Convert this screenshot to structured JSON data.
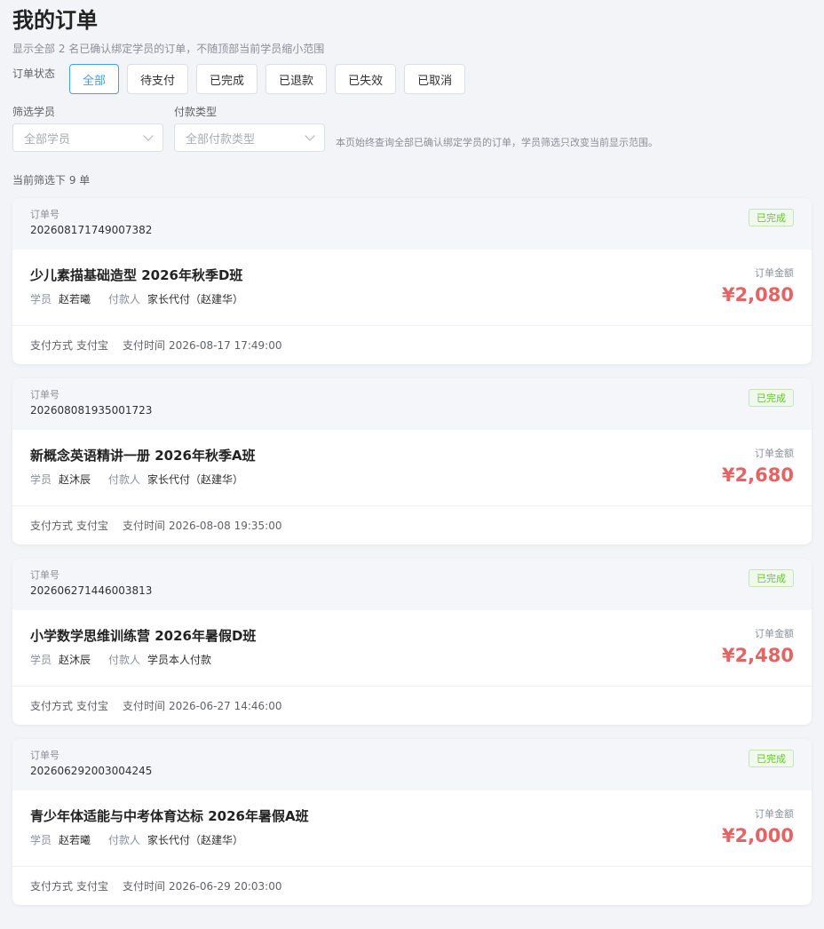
{
  "header": {
    "title": "我的订单",
    "subtitle": "显示全部 2 名已确认绑定学员的订单，不随顶部当前学员缩小范围"
  },
  "status_filter": {
    "label": "订单状态",
    "options": [
      "全部",
      "待支付",
      "已完成",
      "已退款",
      "已失效",
      "已取消"
    ],
    "selected": "全部"
  },
  "filters": {
    "student_label": "筛选学员",
    "student_placeholder": "全部学员",
    "payment_label": "付款类型",
    "payment_placeholder": "全部付款类型",
    "note": "本页始终查询全部已确认绑定学员的订单，学员筛选只改变当前显示范围。"
  },
  "count_text": "当前筛选下 9 单",
  "labels": {
    "order_no": "订单号",
    "amount": "订单金额",
    "student": "学员",
    "payer": "付款人",
    "pay_method": "支付方式",
    "pay_time": "支付时间"
  },
  "colors": {
    "accent": "#409eff",
    "amount": "#e56363",
    "success": "#67c23a"
  },
  "orders": [
    {
      "order_no": "202608171749007382",
      "status": "已完成",
      "course": "少儿素描基础造型 2026年秋季D班",
      "student": "赵若曦",
      "payer": "家长代付（赵建华）",
      "amount": "¥2,080",
      "pay_method": "支付宝",
      "pay_time": "2026-08-17 17:49:00"
    },
    {
      "order_no": "202608081935001723",
      "status": "已完成",
      "course": "新概念英语精讲一册 2026年秋季A班",
      "student": "赵沐辰",
      "payer": "家长代付（赵建华）",
      "amount": "¥2,680",
      "pay_method": "支付宝",
      "pay_time": "2026-08-08 19:35:00"
    },
    {
      "order_no": "202606271446003813",
      "status": "已完成",
      "course": "小学数学思维训练营 2026年暑假D班",
      "student": "赵沐辰",
      "payer": "学员本人付款",
      "amount": "¥2,480",
      "pay_method": "支付宝",
      "pay_time": "2026-06-27 14:46:00"
    },
    {
      "order_no": "202606292003004245",
      "status": "已完成",
      "course": "青少年体适能与中考体育达标 2026年暑假A班",
      "student": "赵若曦",
      "payer": "家长代付（赵建华）",
      "amount": "¥2,000",
      "pay_method": "支付宝",
      "pay_time": "2026-06-29 20:03:00"
    }
  ]
}
